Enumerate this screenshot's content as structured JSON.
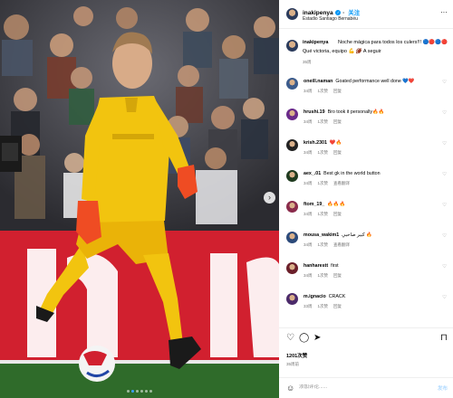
{
  "colors": {
    "accent": "#0095f6",
    "kit_yellow": "#f2c40f",
    "banner_red": "#d1202f",
    "pitch_green": "#2f6b2a"
  },
  "post": {
    "username": "inakipenya",
    "follow_label": "关注",
    "location": "Estadio Santiago Bernabéu",
    "caption_text": "Noche mágica para todos los culers!!! 🔵🔴🔵🔴",
    "caption_line2": "Qué victoria, equipo 💪 🏈 A seguir",
    "caption_time": "35周",
    "likes": "1201次赞",
    "date": "35周前",
    "add_comment_placeholder": "添加评论......",
    "post_label": "发布",
    "more_icon": "more-horizontal-icon"
  },
  "comments": [
    {
      "user": "oneill.naman",
      "text": "Goated performance well done 💙❤️",
      "time": "34周",
      "likes": "1次赞",
      "reply": "回复"
    },
    {
      "user": "hrushi.19",
      "text": "Bro took it personally🔥🔥",
      "time": "34周",
      "likes": "1次赞",
      "reply": "回复"
    },
    {
      "user": "krish.2301",
      "text": "❤️🔥",
      "time": "34周",
      "likes": "1次赞",
      "reply": "回复"
    },
    {
      "user": "aex_.01",
      "text": "Best gk in the world button",
      "time": "34周",
      "likes": "1次赞",
      "reply": "查看翻译"
    },
    {
      "user": "ftom_19_",
      "text": "🔥🔥🔥",
      "time": "34周",
      "likes": "1次赞",
      "reply": "回复"
    },
    {
      "user": "mousa_wakim1",
      "text": "كبير صاحبي 🔥",
      "time": "34周",
      "likes": "1次赞",
      "reply": "查看翻译"
    },
    {
      "user": "hanharestt",
      "text": "first",
      "time": "34周",
      "likes": "1次赞",
      "reply": "回复"
    },
    {
      "user": "m.ignacio",
      "text": "CRACK",
      "time": "33周",
      "likes": "1次赞",
      "reply": "回复"
    }
  ],
  "photo": {
    "carousel_dots": 6,
    "active_dot": 1,
    "next_icon": "chevron-right-icon"
  }
}
